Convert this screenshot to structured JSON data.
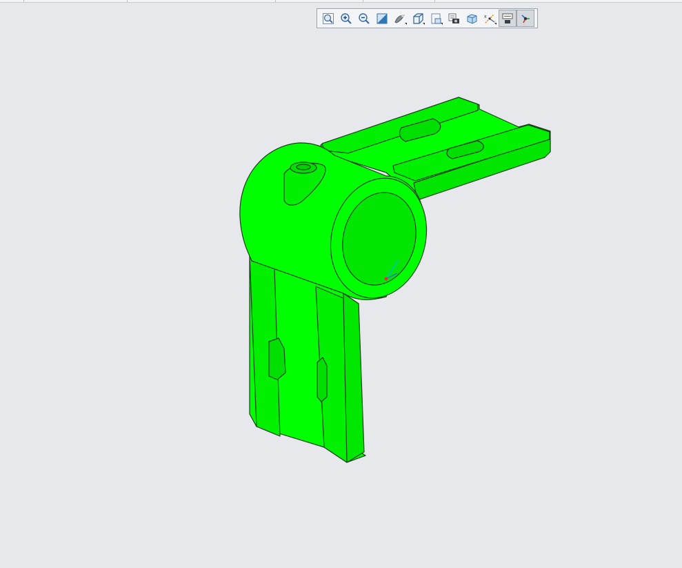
{
  "colors": {
    "background": "#e6e8eb",
    "model_fill": "#00ff00",
    "model_edge": "#1b3d1b"
  },
  "toolbar": {
    "buttons": [
      {
        "icon": "zoom-to-fit-icon",
        "active": false
      },
      {
        "icon": "zoom-in-icon",
        "active": false
      },
      {
        "icon": "zoom-out-icon",
        "active": false
      },
      {
        "icon": "repaint-icon",
        "active": false
      },
      {
        "icon": "display-style-icon",
        "active": false
      },
      {
        "icon": "saved-views-icon",
        "active": false
      },
      {
        "icon": "view-manager-icon",
        "active": false
      },
      {
        "icon": "snapshot-icon",
        "active": false
      },
      {
        "icon": "perspective-view-icon",
        "active": false
      },
      {
        "icon": "datum-display-icon",
        "active": false
      },
      {
        "icon": "annotation-display-icon",
        "active": true
      },
      {
        "icon": "spin-center-icon",
        "active": true
      }
    ]
  },
  "model": {
    "description_icon": "3d-part-model"
  }
}
